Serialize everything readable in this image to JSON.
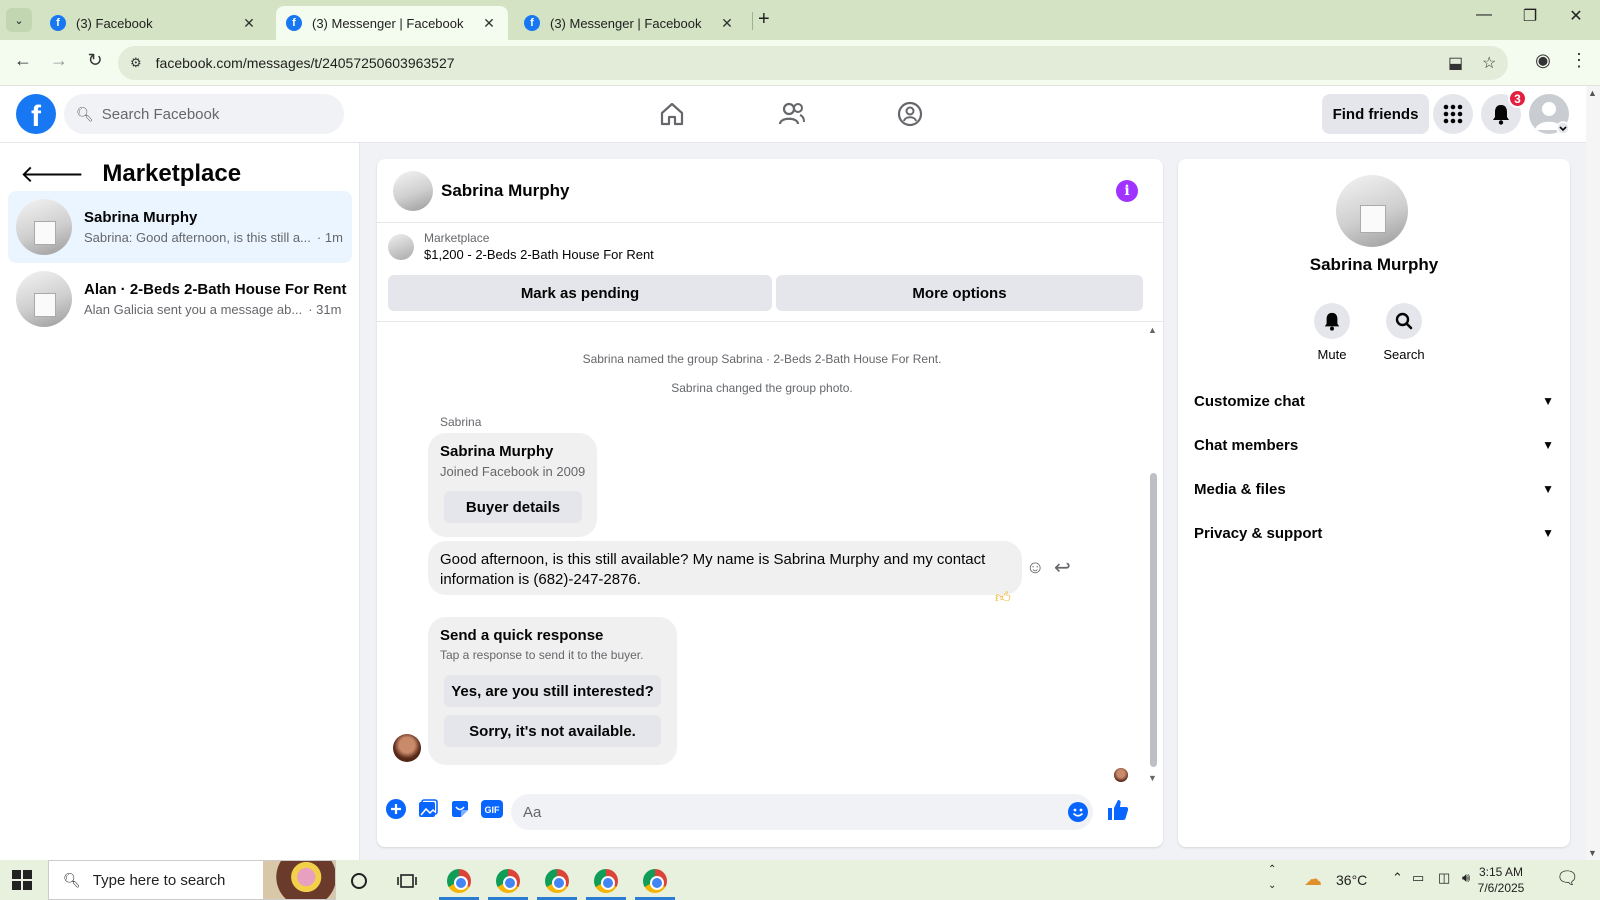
{
  "browser": {
    "tabs": [
      {
        "title": "(3) Facebook",
        "active": false
      },
      {
        "title": "(3) Messenger | Facebook",
        "active": true
      },
      {
        "title": "(3) Messenger | Facebook",
        "active": false
      }
    ],
    "url": "facebook.com/messages/t/24057250603963527"
  },
  "header": {
    "search_placeholder": "Search Facebook",
    "find_friends_label": "Find friends",
    "notifications_count": "3",
    "accent_color": "#1877f2",
    "badge_color": "#e41e3f"
  },
  "sidebar": {
    "title": "Marketplace",
    "conversations": [
      {
        "name": "Sabrina Murphy",
        "preview": "Sabrina: Good afternoon, is this still a...",
        "time": "· 1m",
        "active": true
      },
      {
        "name": "Alan · 2-Beds 2-Bath House For Rent",
        "preview": "Alan Galicia sent you a message ab...",
        "time": "· 31m",
        "active": false
      }
    ]
  },
  "chat": {
    "name": "Sabrina Murphy",
    "listing_label": "Marketplace",
    "listing_title": "$1,200 - 2-Beds 2-Bath House For Rent",
    "mark_pending_label": "Mark as pending",
    "more_options_label": "More options",
    "system_messages": [
      "Sabrina named the group Sabrina · 2-Beds 2-Bath House For Rent.",
      "Sabrina changed the group photo."
    ],
    "sender_label": "Sabrina",
    "buyer_card": {
      "name": "Sabrina Murphy",
      "joined": "Joined Facebook in 2009",
      "button": "Buyer details"
    },
    "message": "Good afternoon, is this still available? My name is Sabrina Murphy and my contact information is (682)-247-2876.",
    "quick_response": {
      "title": "Send a quick response",
      "subtitle": "Tap a response to send it to the buyer.",
      "options": [
        "Yes, are you still interested?",
        "Sorry, it's not available."
      ]
    },
    "composer_placeholder": "Aa"
  },
  "right_panel": {
    "name": "Sabrina Murphy",
    "actions": [
      "Mute",
      "Search"
    ],
    "sections": [
      "Customize chat",
      "Chat members",
      "Media & files",
      "Privacy & support"
    ]
  },
  "taskbar": {
    "search_placeholder": "Type here to search",
    "temperature": "36°C",
    "time": "3:15 AM",
    "date": "7/6/2025"
  }
}
